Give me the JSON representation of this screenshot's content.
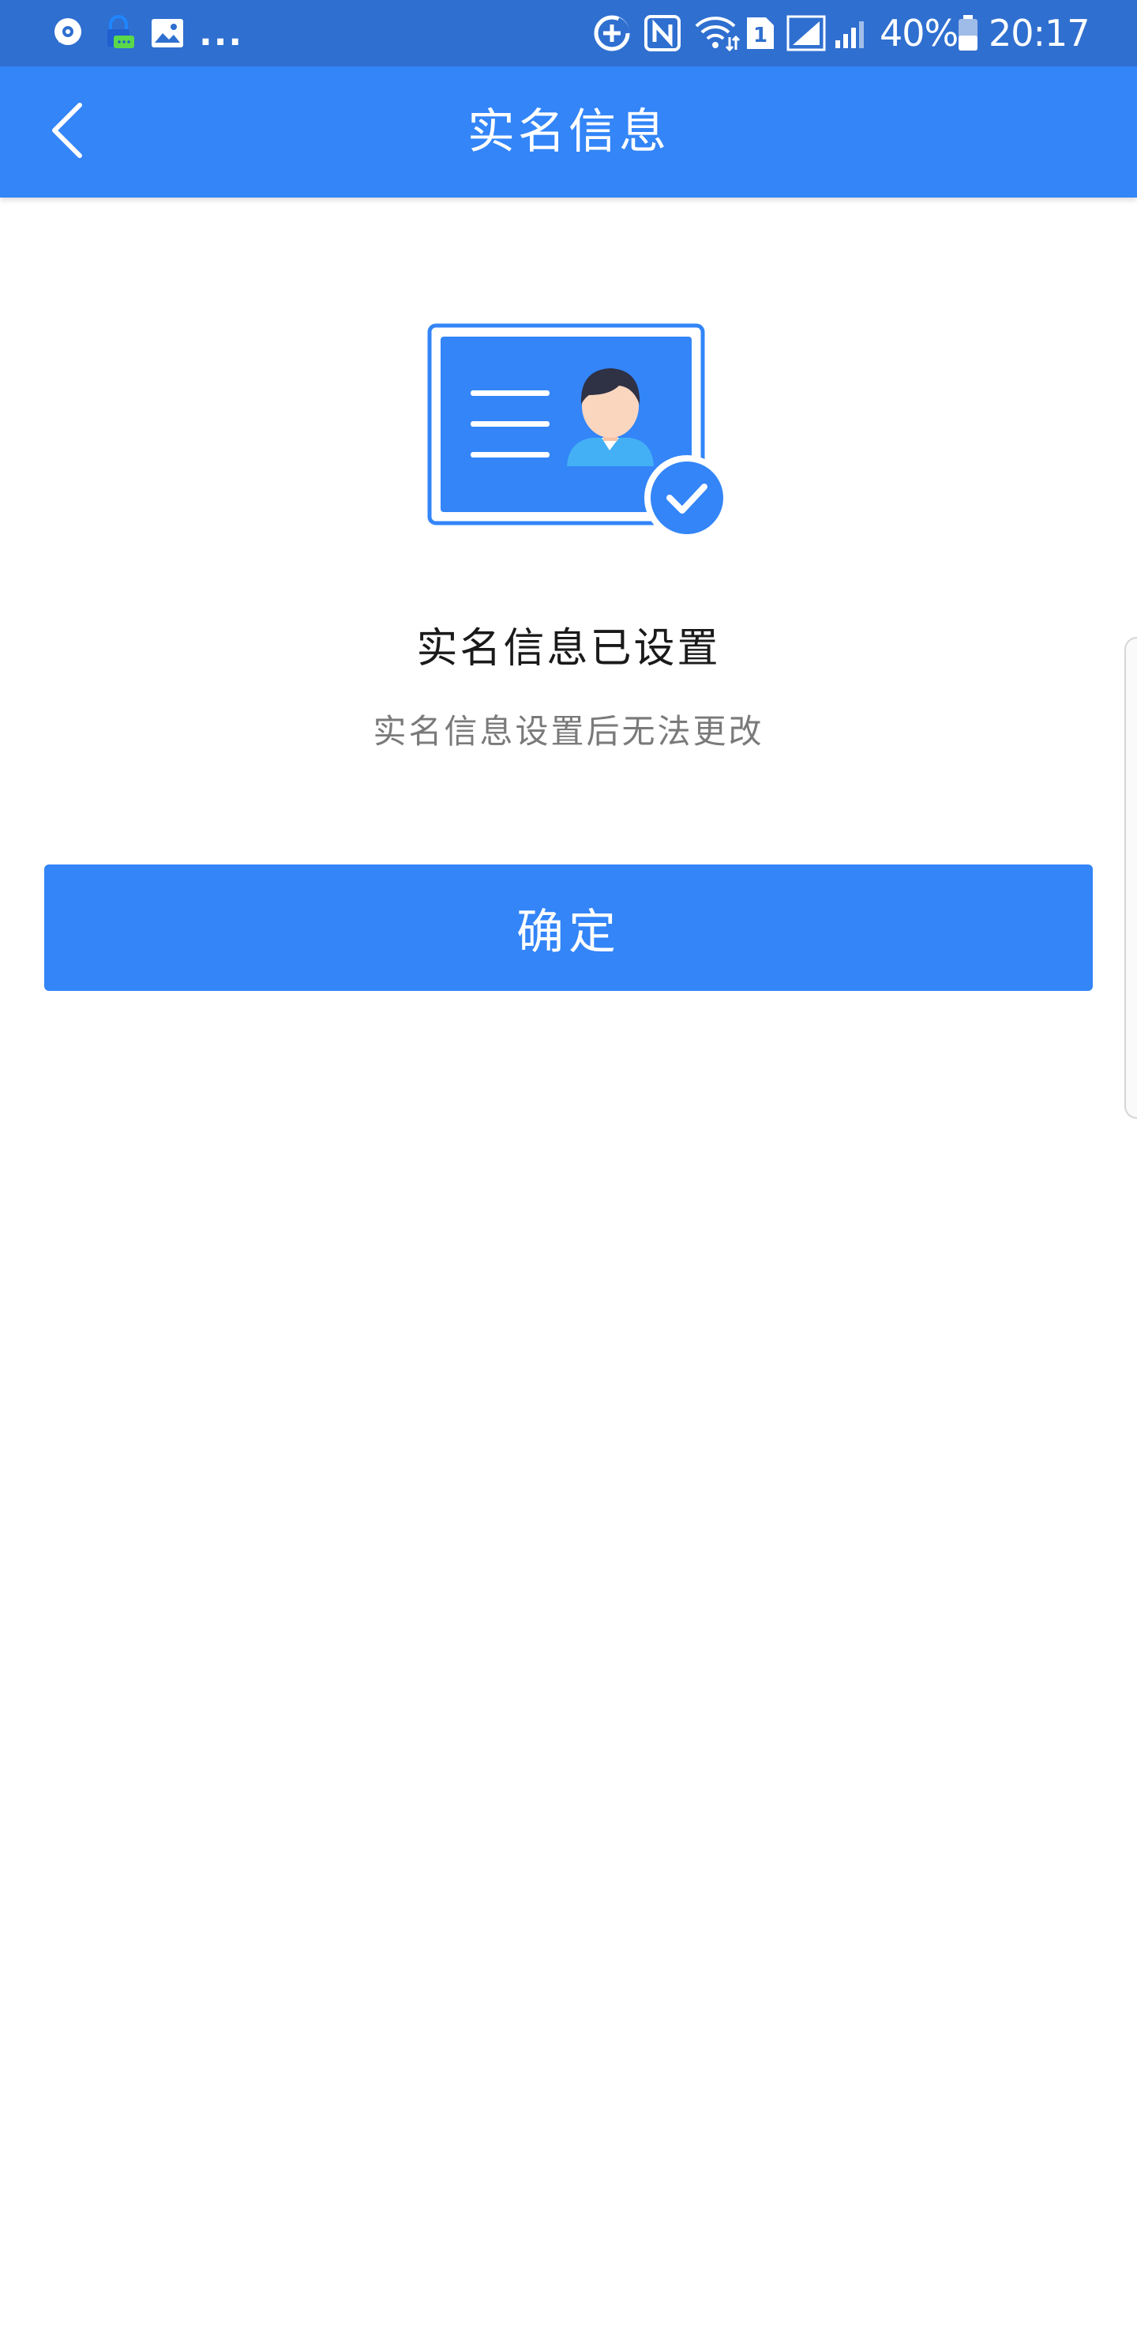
{
  "status_bar": {
    "more_indicator": "...",
    "battery_percent": "40%",
    "time": "20:17",
    "sim_slot": "1",
    "icons": [
      "chat-bubble-icon",
      "lock-message-icon",
      "image-icon",
      "data-saver-icon",
      "nfc-icon",
      "wifi-icon",
      "sim-1-icon",
      "signal-icon",
      "signal-icon",
      "battery-icon"
    ]
  },
  "app_bar": {
    "title": "实名信息",
    "back_icon": "chevron-left-icon"
  },
  "content": {
    "illustration_icon": "id-card-verified-icon",
    "heading": "实名信息已设置",
    "subheading": "实名信息设置后无法更改",
    "confirm_label": "确定"
  },
  "colors": {
    "status_bar": "#2f6fd0",
    "app_bar": "#3385f8",
    "button": "#3385f8",
    "heading_text": "#1a1a1a",
    "subheading_text": "#7a7a7a"
  }
}
